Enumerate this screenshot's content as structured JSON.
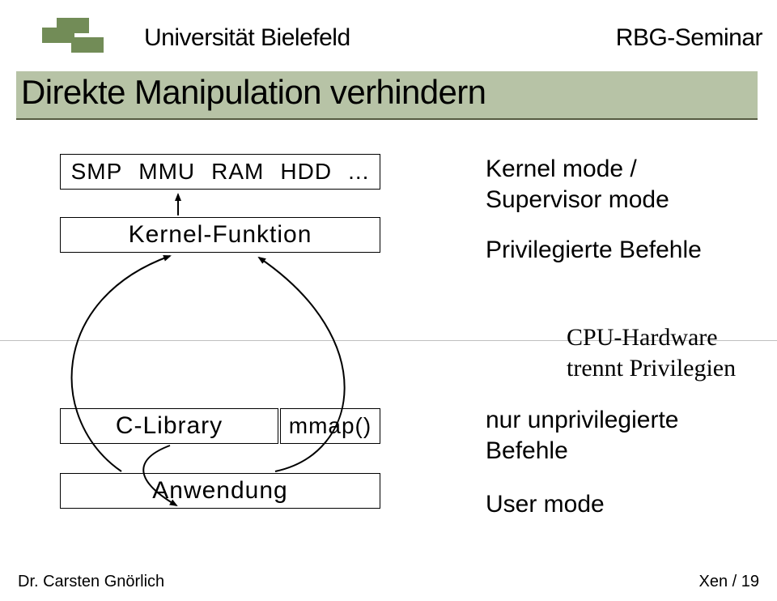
{
  "header": {
    "institution": "Universität Bielefeld",
    "seminar": "RBG-Seminar"
  },
  "title": "Direkte Manipulation verhindern",
  "diagram": {
    "hardware_row": [
      "SMP",
      "MMU",
      "RAM",
      "HDD",
      "..."
    ],
    "kernel_box": "Kernel-Funktion",
    "clib_box": "C-Library",
    "mmap_box": "mmap()",
    "app_box": "Anwendung"
  },
  "annotations": {
    "kernel_mode_line1": "Kernel mode /",
    "kernel_mode_line2": "Supervisor mode",
    "priv_cmds": "Privilegierte Befehle",
    "cpu_hw_line1": "CPU-Hardware",
    "cpu_hw_line2": "trennt Privilegien",
    "unpriv_line1": "nur unprivilegierte",
    "unpriv_line2": "Befehle",
    "user_mode": "User mode"
  },
  "footer": {
    "author": "Dr. Carsten Gnörlich",
    "page_label": "Xen / 19"
  }
}
